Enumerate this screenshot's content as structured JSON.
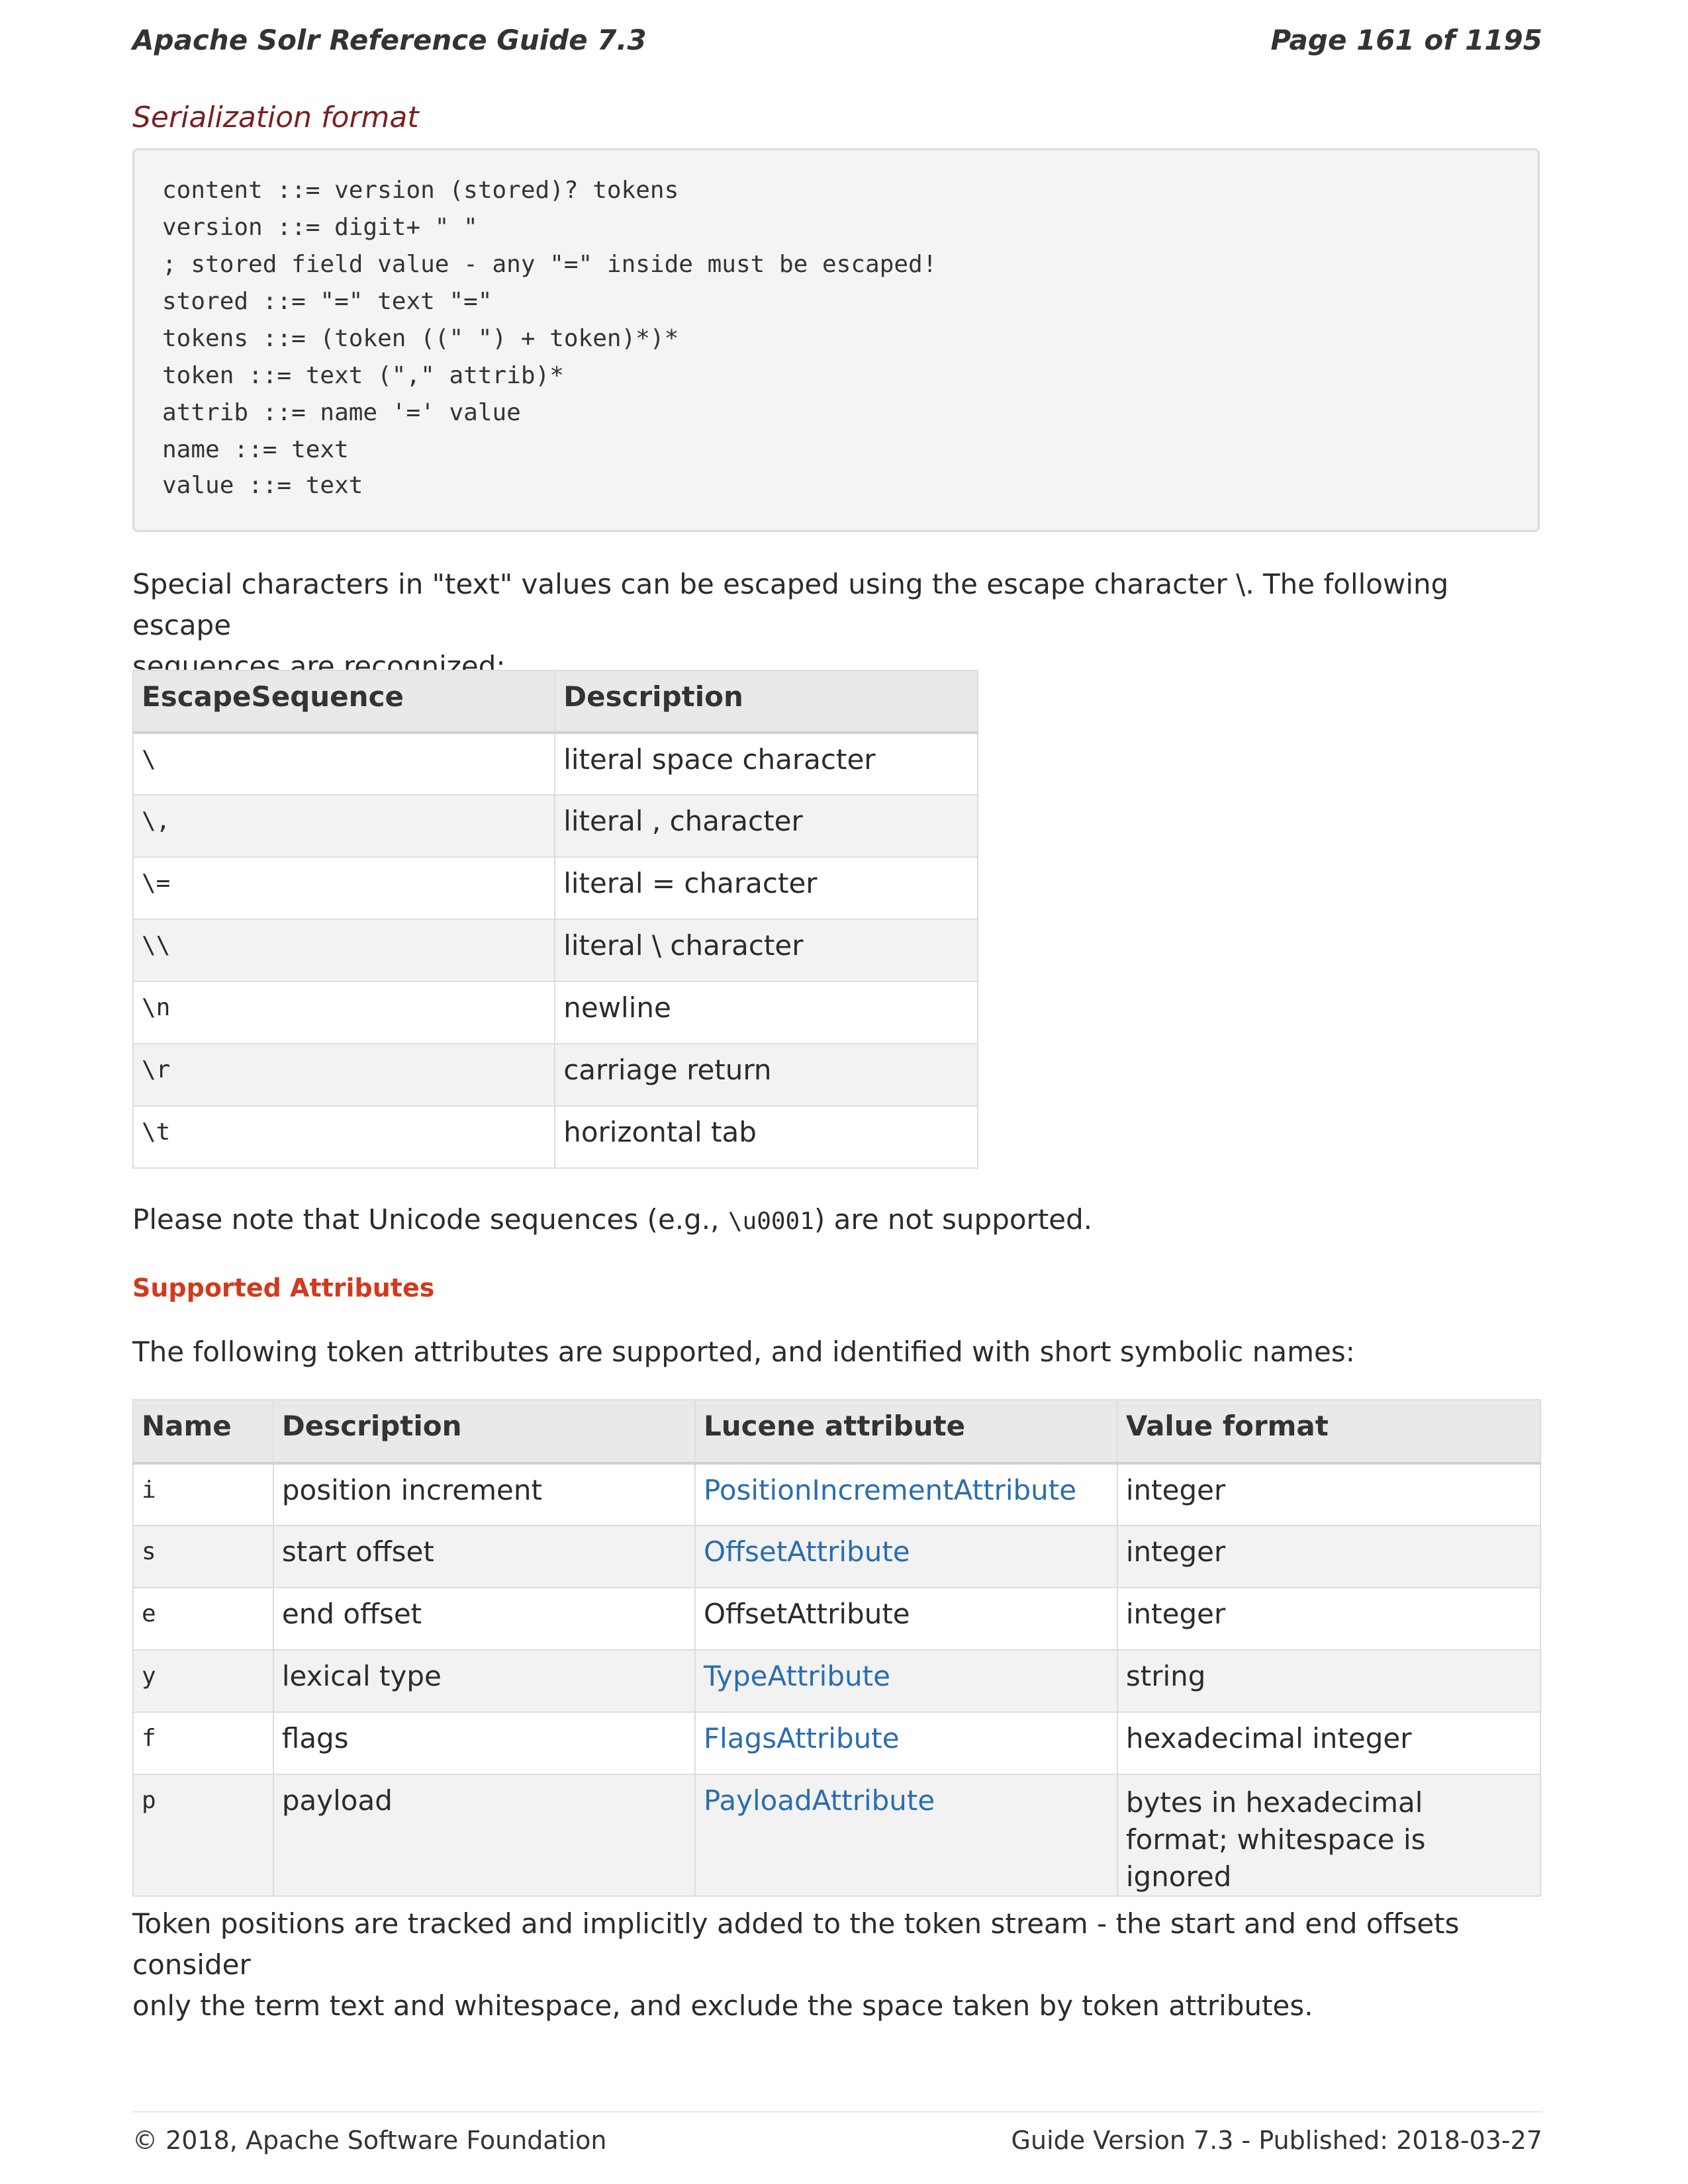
{
  "header": {
    "title": "Apache Solr Reference Guide 7.3",
    "page": "Page 161 of 1195"
  },
  "serialization_heading": "Serialization format",
  "code_lines": [
    "content ::= version (stored)? tokens",
    "version ::= digit+ \" \"",
    "; stored field value - any \"=\" inside must be escaped!",
    "stored ::= \"=\" text \"=\"",
    "tokens ::= (token ((\" \") + token)*)*",
    "token ::= text (\",\" attrib)*",
    "attrib ::= name '=' value",
    "name ::= text",
    "value ::= text"
  ],
  "escape_intro": {
    "line1": "Special characters in \"text\" values can be escaped using the escape character \\. The following escape",
    "line2": "sequences are recognized:"
  },
  "escape_table": {
    "headers": [
      "EscapeSequence",
      "Description"
    ],
    "rows": [
      {
        "seq": "\\",
        "desc": "literal space character"
      },
      {
        "seq": "\\,",
        "desc": "literal , character"
      },
      {
        "seq": "\\=",
        "desc": "literal = character"
      },
      {
        "seq": "\\\\",
        "desc": "literal \\ character"
      },
      {
        "seq": "\\n",
        "desc": "newline"
      },
      {
        "seq": "\\r",
        "desc": "carriage return"
      },
      {
        "seq": "\\t",
        "desc": "horizontal tab"
      }
    ]
  },
  "unicode_note": {
    "before": "Please note that Unicode sequences (e.g., ",
    "code": "\\u0001",
    "after": ") are not supported."
  },
  "supported_heading": "Supported Attributes",
  "attributes_intro": "The following token attributes are supported, and identified with short symbolic names:",
  "attributes_table": {
    "headers": [
      "Name",
      "Description",
      "Lucene attribute",
      "Value format"
    ],
    "rows": [
      {
        "name": "i",
        "desc": "position increment",
        "attr": "PositionIncrementAttribute",
        "format": "integer"
      },
      {
        "name": "s",
        "desc": "start offset",
        "attr": "OffsetAttribute",
        "format": "integer"
      },
      {
        "name": "e",
        "desc": "end offset",
        "attr": "OffsetAttribute",
        "format": "integer"
      },
      {
        "name": "y",
        "desc": "lexical type",
        "attr": "TypeAttribute",
        "format": "string"
      },
      {
        "name": "f",
        "desc": "flags",
        "attr": "FlagsAttribute",
        "format": "hexadecimal integer"
      },
      {
        "name": "p",
        "desc": "payload",
        "attr": "PayloadAttribute",
        "format": "bytes in hexadecimal format; whitespace is ignored"
      }
    ]
  },
  "closing_paragraph": {
    "line1": "Token positions are tracked and implicitly added to the token stream - the start and end offsets consider",
    "line2": "only the term text and whitespace, and exclude the space taken by token attributes."
  },
  "footer": {
    "left": "© 2018, Apache Software Foundation",
    "right": "Guide Version 7.3 - Published: 2018-03-27"
  },
  "colors": {
    "subheading": "#7a1f1f",
    "section_heading": "#d23a1d",
    "link": "#2a6db0"
  }
}
